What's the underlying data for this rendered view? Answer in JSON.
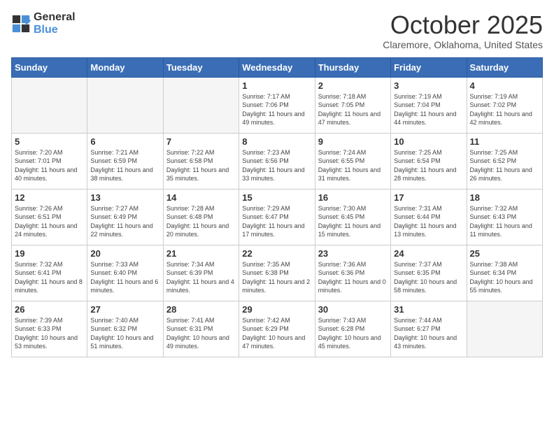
{
  "logo": {
    "general": "General",
    "blue": "Blue"
  },
  "title": "October 2025",
  "location": "Claremore, Oklahoma, United States",
  "days_of_week": [
    "Sunday",
    "Monday",
    "Tuesday",
    "Wednesday",
    "Thursday",
    "Friday",
    "Saturday"
  ],
  "weeks": [
    [
      {
        "day": "",
        "info": ""
      },
      {
        "day": "",
        "info": ""
      },
      {
        "day": "",
        "info": ""
      },
      {
        "day": "1",
        "info": "Sunrise: 7:17 AM\nSunset: 7:06 PM\nDaylight: 11 hours and 49 minutes."
      },
      {
        "day": "2",
        "info": "Sunrise: 7:18 AM\nSunset: 7:05 PM\nDaylight: 11 hours and 47 minutes."
      },
      {
        "day": "3",
        "info": "Sunrise: 7:19 AM\nSunset: 7:04 PM\nDaylight: 11 hours and 44 minutes."
      },
      {
        "day": "4",
        "info": "Sunrise: 7:19 AM\nSunset: 7:02 PM\nDaylight: 11 hours and 42 minutes."
      }
    ],
    [
      {
        "day": "5",
        "info": "Sunrise: 7:20 AM\nSunset: 7:01 PM\nDaylight: 11 hours and 40 minutes."
      },
      {
        "day": "6",
        "info": "Sunrise: 7:21 AM\nSunset: 6:59 PM\nDaylight: 11 hours and 38 minutes."
      },
      {
        "day": "7",
        "info": "Sunrise: 7:22 AM\nSunset: 6:58 PM\nDaylight: 11 hours and 35 minutes."
      },
      {
        "day": "8",
        "info": "Sunrise: 7:23 AM\nSunset: 6:56 PM\nDaylight: 11 hours and 33 minutes."
      },
      {
        "day": "9",
        "info": "Sunrise: 7:24 AM\nSunset: 6:55 PM\nDaylight: 11 hours and 31 minutes."
      },
      {
        "day": "10",
        "info": "Sunrise: 7:25 AM\nSunset: 6:54 PM\nDaylight: 11 hours and 28 minutes."
      },
      {
        "day": "11",
        "info": "Sunrise: 7:25 AM\nSunset: 6:52 PM\nDaylight: 11 hours and 26 minutes."
      }
    ],
    [
      {
        "day": "12",
        "info": "Sunrise: 7:26 AM\nSunset: 6:51 PM\nDaylight: 11 hours and 24 minutes."
      },
      {
        "day": "13",
        "info": "Sunrise: 7:27 AM\nSunset: 6:49 PM\nDaylight: 11 hours and 22 minutes."
      },
      {
        "day": "14",
        "info": "Sunrise: 7:28 AM\nSunset: 6:48 PM\nDaylight: 11 hours and 20 minutes."
      },
      {
        "day": "15",
        "info": "Sunrise: 7:29 AM\nSunset: 6:47 PM\nDaylight: 11 hours and 17 minutes."
      },
      {
        "day": "16",
        "info": "Sunrise: 7:30 AM\nSunset: 6:45 PM\nDaylight: 11 hours and 15 minutes."
      },
      {
        "day": "17",
        "info": "Sunrise: 7:31 AM\nSunset: 6:44 PM\nDaylight: 11 hours and 13 minutes."
      },
      {
        "day": "18",
        "info": "Sunrise: 7:32 AM\nSunset: 6:43 PM\nDaylight: 11 hours and 11 minutes."
      }
    ],
    [
      {
        "day": "19",
        "info": "Sunrise: 7:32 AM\nSunset: 6:41 PM\nDaylight: 11 hours and 8 minutes."
      },
      {
        "day": "20",
        "info": "Sunrise: 7:33 AM\nSunset: 6:40 PM\nDaylight: 11 hours and 6 minutes."
      },
      {
        "day": "21",
        "info": "Sunrise: 7:34 AM\nSunset: 6:39 PM\nDaylight: 11 hours and 4 minutes."
      },
      {
        "day": "22",
        "info": "Sunrise: 7:35 AM\nSunset: 6:38 PM\nDaylight: 11 hours and 2 minutes."
      },
      {
        "day": "23",
        "info": "Sunrise: 7:36 AM\nSunset: 6:36 PM\nDaylight: 11 hours and 0 minutes."
      },
      {
        "day": "24",
        "info": "Sunrise: 7:37 AM\nSunset: 6:35 PM\nDaylight: 10 hours and 58 minutes."
      },
      {
        "day": "25",
        "info": "Sunrise: 7:38 AM\nSunset: 6:34 PM\nDaylight: 10 hours and 55 minutes."
      }
    ],
    [
      {
        "day": "26",
        "info": "Sunrise: 7:39 AM\nSunset: 6:33 PM\nDaylight: 10 hours and 53 minutes."
      },
      {
        "day": "27",
        "info": "Sunrise: 7:40 AM\nSunset: 6:32 PM\nDaylight: 10 hours and 51 minutes."
      },
      {
        "day": "28",
        "info": "Sunrise: 7:41 AM\nSunset: 6:31 PM\nDaylight: 10 hours and 49 minutes."
      },
      {
        "day": "29",
        "info": "Sunrise: 7:42 AM\nSunset: 6:29 PM\nDaylight: 10 hours and 47 minutes."
      },
      {
        "day": "30",
        "info": "Sunrise: 7:43 AM\nSunset: 6:28 PM\nDaylight: 10 hours and 45 minutes."
      },
      {
        "day": "31",
        "info": "Sunrise: 7:44 AM\nSunset: 6:27 PM\nDaylight: 10 hours and 43 minutes."
      },
      {
        "day": "",
        "info": ""
      }
    ]
  ]
}
